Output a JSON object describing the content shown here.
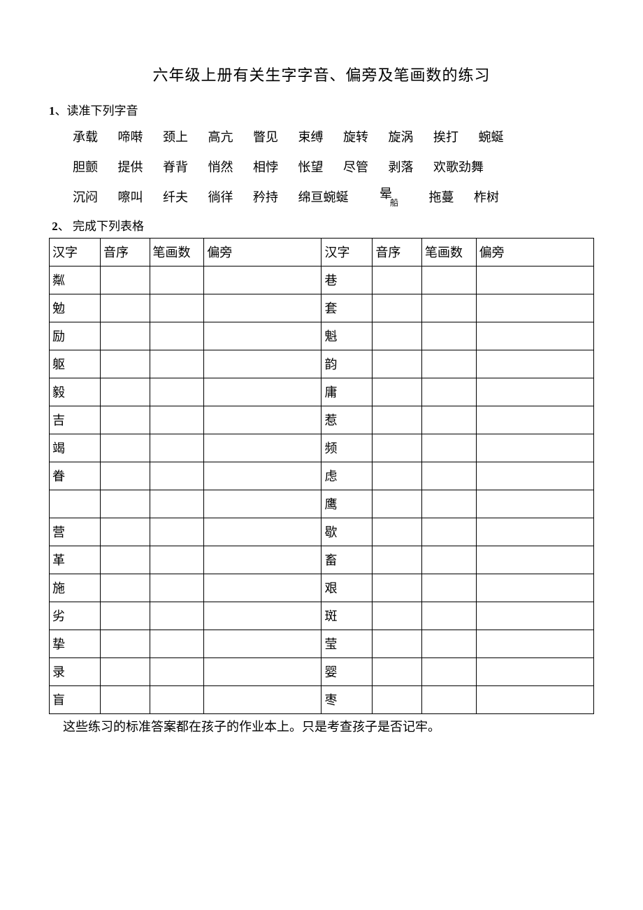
{
  "title": "六年级上册有关生字字音、偏旁及笔画数的练习",
  "section1": {
    "num": "1",
    "label": "、读准下列字音",
    "rows": [
      [
        "承载",
        "啼啭",
        "颈上",
        "高亢",
        "瞥见",
        "束缚",
        "旋转",
        "旋涡",
        "挨打",
        "蜿蜒"
      ],
      [
        "胆颤",
        "提供",
        "脊背",
        "悄然",
        "相悖",
        "怅望",
        "尽管",
        "剥落",
        "欢歌劲舞"
      ],
      [
        "沉闷",
        "嚓叫",
        "纤夫",
        "徜徉",
        "矜持",
        "绵亘蜿蜒"
      ]
    ],
    "row3_extra": {
      "stacked_top": "晕",
      "stacked_bot": "船",
      "w1": "拖蔓",
      "w2": "柞树"
    }
  },
  "section2": {
    "num": "2",
    "label": "、   完成下列表格",
    "headers": [
      "汉字",
      "音序",
      "笔画数",
      "偏旁",
      "汉字",
      "音序",
      "笔画数",
      "偏旁"
    ],
    "rows": [
      [
        "粼",
        "",
        "",
        "",
        "巷",
        "",
        "",
        ""
      ],
      [
        "勉",
        "",
        "",
        "",
        "套",
        "",
        "",
        ""
      ],
      [
        "励",
        "",
        "",
        "",
        "魁",
        "",
        "",
        ""
      ],
      [
        "躯",
        "",
        "",
        "",
        "韵",
        "",
        "",
        ""
      ],
      [
        "毅",
        "",
        "",
        "",
        "庸",
        "",
        "",
        ""
      ],
      [
        "吉",
        "",
        "",
        "",
        "惹",
        "",
        "",
        ""
      ],
      [
        "竭",
        "",
        "",
        "",
        "频",
        "",
        "",
        ""
      ],
      [
        "眷",
        "",
        "",
        "",
        "虑",
        "",
        "",
        ""
      ],
      [
        "",
        "",
        "",
        "",
        "鹰",
        "",
        "",
        ""
      ],
      [
        "营",
        "",
        "",
        "",
        "歇",
        "",
        "",
        ""
      ],
      [
        "革",
        "",
        "",
        "",
        "畜",
        "",
        "",
        ""
      ],
      [
        "施",
        "",
        "",
        "",
        "艰",
        "",
        "",
        ""
      ],
      [
        "劣",
        "",
        "",
        "",
        "斑",
        "",
        "",
        ""
      ],
      [
        "挚",
        "",
        "",
        "",
        "莹",
        "",
        "",
        ""
      ],
      [
        "录",
        "",
        "",
        "",
        "婴",
        "",
        "",
        ""
      ],
      [
        "盲",
        "",
        "",
        "",
        "枣",
        "",
        "",
        ""
      ]
    ]
  },
  "footer": "这些练习的标准答案都在孩子的作业本上。只是考查孩子是否记牢。"
}
